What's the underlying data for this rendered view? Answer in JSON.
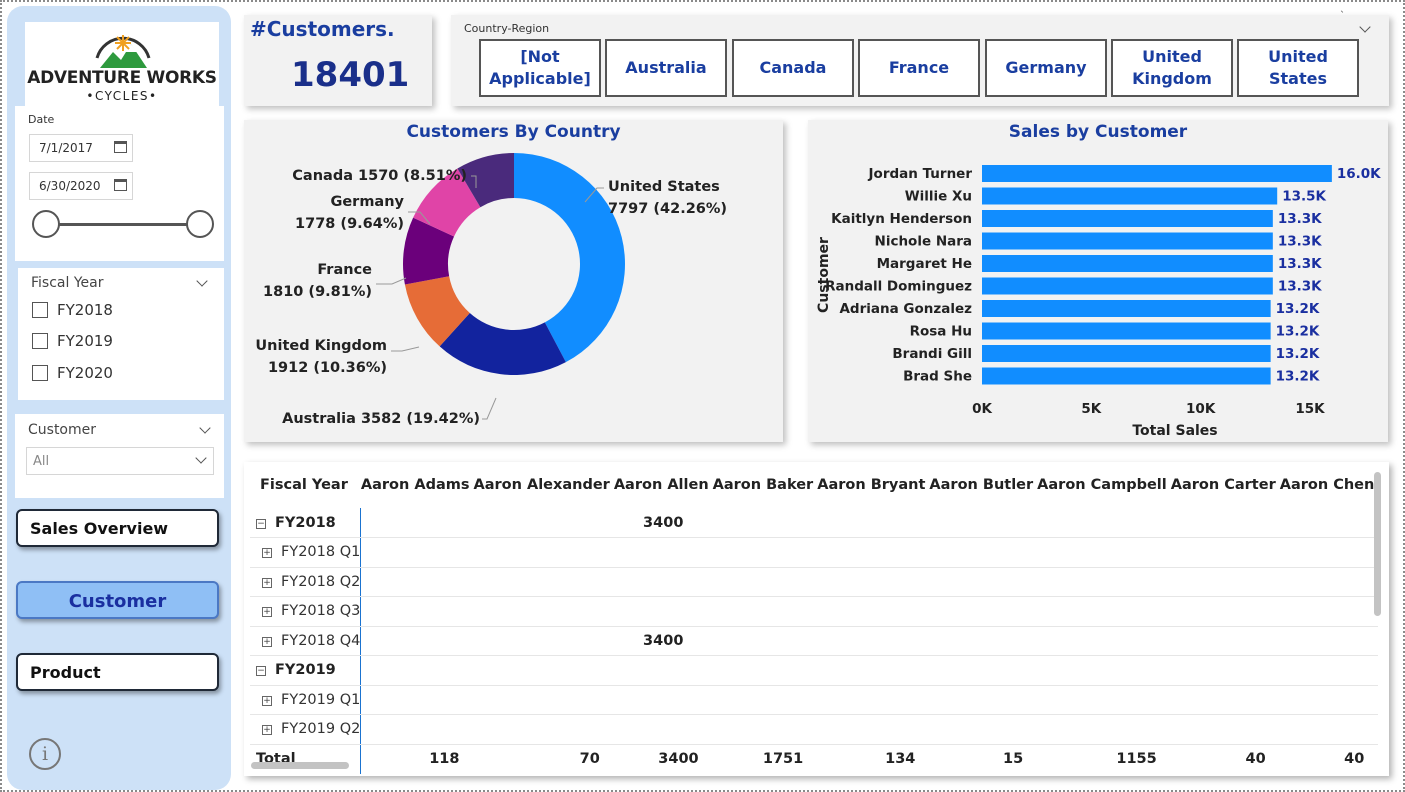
{
  "logo": {
    "title": "ADVENTURE WORKS",
    "subtitle": "•CYCLES•"
  },
  "date_filter": {
    "label": "Date",
    "start": "7/1/2017",
    "end": "6/30/2020"
  },
  "fiscal_year_filter": {
    "label": "Fiscal Year",
    "options": [
      "FY2018",
      "FY2019",
      "FY2020"
    ]
  },
  "customer_filter": {
    "label": "Customer",
    "value": "All"
  },
  "nav": {
    "sales_overview": "Sales Overview",
    "customer": "Customer",
    "product": "Product"
  },
  "kpi": {
    "title": "#Customers.",
    "value": "18401"
  },
  "country_region": {
    "label": "Country-Region",
    "buttons": [
      "[Not Applicable]",
      "Australia",
      "Canada",
      "France",
      "Germany",
      "United Kingdom",
      "United States"
    ]
  },
  "donut": {
    "title": "Customers By Country",
    "labels": [
      {
        "line1": "United States",
        "line2": "7797 (42.26%)"
      },
      {
        "line1": "Australia 3582 (19.42%)",
        "line2": ""
      },
      {
        "line1": "United Kingdom",
        "line2": "1912 (10.36%)"
      },
      {
        "line1": "France",
        "line2": "1810 (9.81%)"
      },
      {
        "line1": "Germany",
        "line2": "1778 (9.64%)"
      },
      {
        "line1": "Canada 1570 (8.51%)",
        "line2": ""
      }
    ]
  },
  "bar": {
    "title": "Sales by Customer",
    "ylabel": "Customer",
    "xlabel": "Total Sales",
    "ticks": [
      "0K",
      "5K",
      "10K",
      "15K"
    ]
  },
  "chart_data": [
    {
      "type": "pie",
      "title": "Customers By Country",
      "categories": [
        "United States",
        "Australia",
        "United Kingdom",
        "France",
        "Germany",
        "Canada"
      ],
      "values": [
        7797,
        3582,
        1912,
        1810,
        1778,
        1570
      ],
      "percentages": [
        42.26,
        19.42,
        10.36,
        9.81,
        9.64,
        8.51
      ],
      "colors": [
        "#118dff",
        "#12239e",
        "#e66c37",
        "#6b007b",
        "#e044a7",
        "#4a2a7c"
      ],
      "legend": "none"
    },
    {
      "type": "bar",
      "title": "Sales by Customer",
      "xlabel": "Total Sales",
      "ylabel": "Customer",
      "categories": [
        "Jordan Turner",
        "Willie Xu",
        "Kaitlyn Henderson",
        "Nichole Nara",
        "Margaret He",
        "Randall Dominguez",
        "Adriana Gonzalez",
        "Rosa Hu",
        "Brandi Gill",
        "Brad She"
      ],
      "values": [
        16000,
        13500,
        13300,
        13300,
        13300,
        13300,
        13200,
        13200,
        13200,
        13200
      ],
      "data_labels": [
        "16.0K",
        "13.5K",
        "13.3K",
        "13.3K",
        "13.3K",
        "13.3K",
        "13.2K",
        "13.2K",
        "13.2K",
        "13.2K"
      ],
      "xlim": [
        0,
        16000
      ],
      "orientation": "horizontal",
      "color": "#118dff",
      "grid": false
    }
  ],
  "matrix": {
    "row_header": "Fiscal Year",
    "columns": [
      "Aaron Adams",
      "Aaron Alexander",
      "Aaron Allen",
      "Aaron Baker",
      "Aaron Bryant",
      "Aaron Butler",
      "Aaron Campbell",
      "Aaron Carter",
      "Aaron Chen"
    ],
    "rows": [
      {
        "label": "FY2018",
        "level": 0,
        "toggle": "−",
        "values": [
          "",
          "",
          "3400",
          "",
          "",
          "",
          "",
          "",
          ""
        ]
      },
      {
        "label": "FY2018 Q1",
        "level": 1,
        "toggle": "+",
        "values": [
          "",
          "",
          "",
          "",
          "",
          "",
          "",
          "",
          ""
        ]
      },
      {
        "label": "FY2018 Q2",
        "level": 1,
        "toggle": "+",
        "values": [
          "",
          "",
          "",
          "",
          "",
          "",
          "",
          "",
          ""
        ]
      },
      {
        "label": "FY2018 Q3",
        "level": 1,
        "toggle": "+",
        "values": [
          "",
          "",
          "",
          "",
          "",
          "",
          "",
          "",
          ""
        ]
      },
      {
        "label": "FY2018 Q4",
        "level": 1,
        "toggle": "+",
        "values": [
          "",
          "",
          "3400",
          "",
          "",
          "",
          "",
          "",
          ""
        ]
      },
      {
        "label": "FY2019",
        "level": 0,
        "toggle": "−",
        "values": [
          "",
          "",
          "",
          "",
          "",
          "",
          "",
          "",
          ""
        ]
      },
      {
        "label": "FY2019 Q1",
        "level": 1,
        "toggle": "+",
        "values": [
          "",
          "",
          "",
          "",
          "",
          "",
          "",
          "",
          ""
        ]
      },
      {
        "label": "FY2019 Q2",
        "level": 1,
        "toggle": "+",
        "values": [
          "",
          "",
          "",
          "",
          "",
          "",
          "",
          "",
          ""
        ]
      }
    ],
    "total": {
      "label": "Total",
      "values": [
        "118",
        "70",
        "3400",
        "1751",
        "134",
        "15",
        "1155",
        "40",
        "40"
      ]
    }
  }
}
